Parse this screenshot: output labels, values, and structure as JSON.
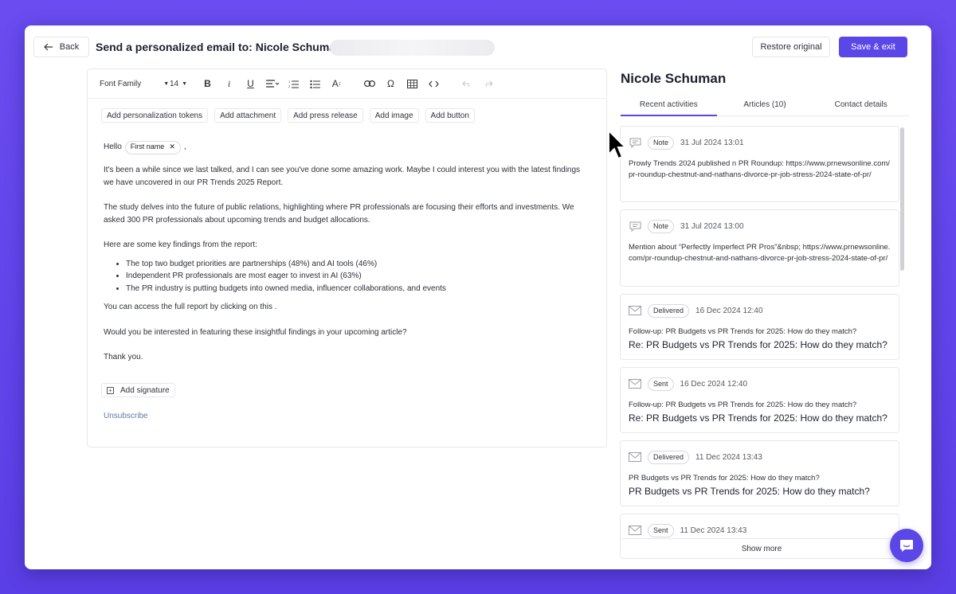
{
  "header": {
    "back_label": "Back",
    "title": "Send a personalized email to: Nicole Schuman (",
    "restore_label": "Restore original",
    "save_label": "Save & exit"
  },
  "toolbar": {
    "font_family": "Font Family",
    "font_size": "14",
    "icons": [
      "bold-icon",
      "italic-icon",
      "underline-icon",
      "align-icon",
      "numbered-list-icon",
      "bullet-list-icon",
      "text-size-icon",
      "link-icon",
      "omega-icon",
      "table-icon",
      "code-icon",
      "undo-icon",
      "redo-icon"
    ]
  },
  "insert_buttons": [
    "Add personalization tokens",
    "Add attachment",
    "Add press release",
    "Add image",
    "Add button"
  ],
  "email": {
    "greeting": "Hello",
    "token_label": "First name",
    "greeting_suffix": ",",
    "para1": "It's been a while since we last talked, and I can see you've done some amazing work. Maybe I could interest you with the latest findings we have uncovered in our PR Trends 2025 Report.",
    "para2": "The study delves into the future of public relations, highlighting where PR professionals are focusing their efforts and investments. We asked 300 PR professionals about upcoming trends and budget allocations.",
    "para3": "Here are some key findings from the report:",
    "bullets": [
      "The top two budget priorities are partnerships (48%) and AI tools (46%)",
      "Independent PR professionals are most eager to invest in AI (63%)",
      "The PR industry is putting budgets into owned media, influencer collaborations, and events"
    ],
    "para4": "You can access the full report by clicking on this .",
    "para5": "Would you be interested in featuring these insightful findings in your upcoming article?",
    "para6": "Thank you.",
    "add_signature": "Add signature",
    "unsubscribe": "Unsubscribe"
  },
  "contact": {
    "name": "Nicole Schuman",
    "tabs": [
      "Recent activities",
      "Articles (10)",
      "Contact details"
    ],
    "active_tab": 0
  },
  "activities": [
    {
      "icon": "note-icon",
      "badge": "Note",
      "date": "31 Jul 2024 13:01",
      "text": "Prowly Trends 2024 published n PR Roundup: https://www.prnewsonline.com/pr-roundup-chestnut-and-nathans-divorce-pr-job-stress-2024-state-of-pr/",
      "subject": ""
    },
    {
      "icon": "note-icon",
      "badge": "Note",
      "date": "31 Jul 2024 13:00",
      "text": "Mention about “Perfectly Imperfect PR Pros”&nbsp; https://www.prnewsonline.com/pr-roundup-chestnut-and-nathans-divorce-pr-job-stress-2024-state-of-pr/",
      "subject": ""
    },
    {
      "icon": "mail-icon",
      "badge": "Delivered",
      "date": "16 Dec 2024 12:40",
      "text": "Follow-up: PR Budgets vs PR Trends for 2025: How do they match?",
      "subject": "Re: PR Budgets vs PR Trends for 2025: How do they match?"
    },
    {
      "icon": "mail-icon",
      "badge": "Sent",
      "date": "16 Dec 2024 12:40",
      "text": "Follow-up: PR Budgets vs PR Trends for 2025: How do they match?",
      "subject": "Re: PR Budgets vs PR Trends for 2025: How do they match?"
    },
    {
      "icon": "mail-icon",
      "badge": "Delivered",
      "date": "11 Dec 2024 13:43",
      "text": "PR Budgets vs PR Trends for 2025: How do they match?",
      "subject": "PR Budgets vs PR Trends for 2025: How do they match?"
    },
    {
      "icon": "mail-icon",
      "badge": "Sent",
      "date": "11 Dec 2024 13:43",
      "text": "",
      "subject": ""
    }
  ],
  "show_more": "Show more",
  "colors": {
    "accent": "#5b46e8",
    "background": "#6a4cf0",
    "link": "#6177a8"
  }
}
